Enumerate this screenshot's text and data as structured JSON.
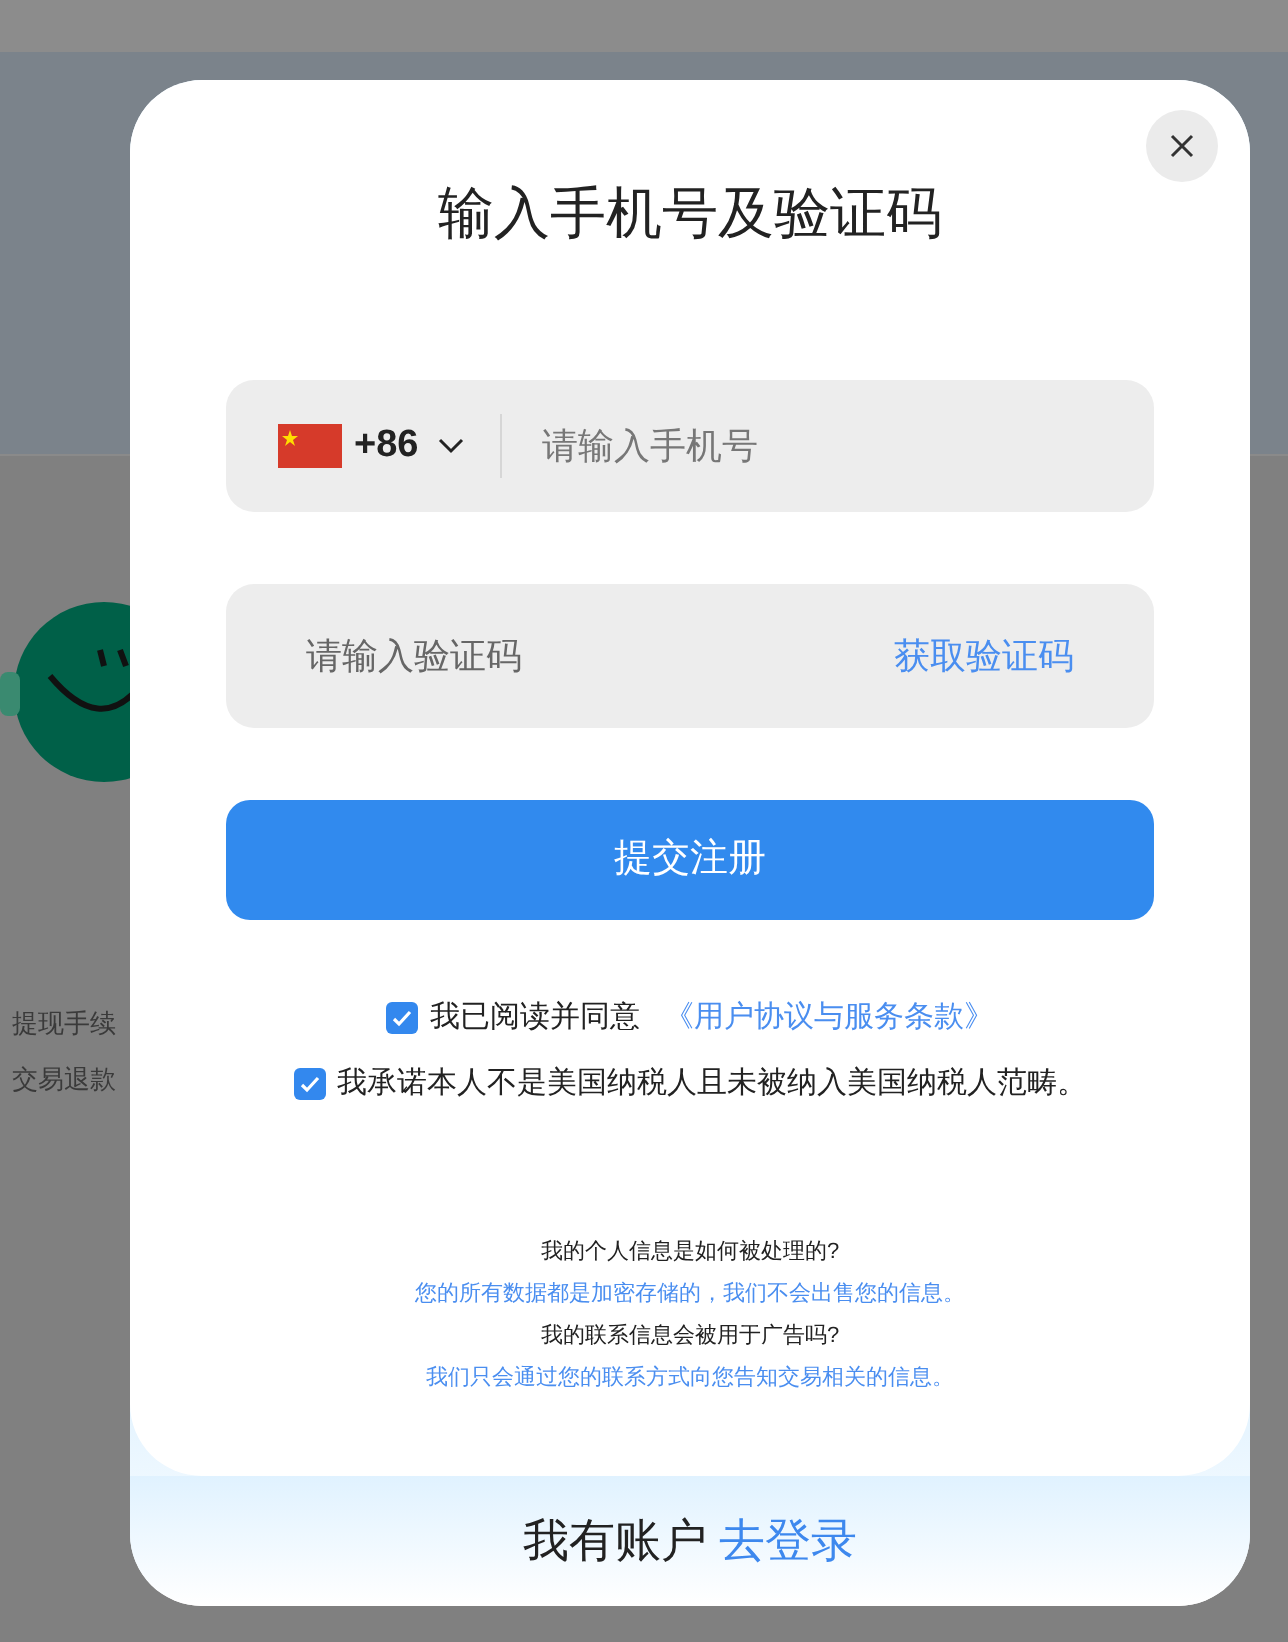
{
  "background": {
    "texts": [
      "提现手续",
      "交易退款"
    ]
  },
  "dialog": {
    "title": "输入手机号及验证码",
    "phone": {
      "country_code": "+86",
      "placeholder": "请输入手机号"
    },
    "code": {
      "placeholder": "请输入验证码",
      "get_code": "获取验证码"
    },
    "submit": "提交注册",
    "agreements": [
      {
        "text": "我已阅读并同意",
        "link": "《用户协议与服务条款》",
        "checked": true
      },
      {
        "text": "我承诺本人不是美国纳税人且未被纳入美国纳税人范畴。",
        "checked": true
      }
    ],
    "faq": [
      {
        "question": "我的个人信息是如何被处理的?",
        "answer": "您的所有数据都是加密存储的，我们不会出售您的信息。"
      },
      {
        "question": "我的联系信息会被用于广告吗?",
        "answer": "我们只会通过您的联系方式向您告知交易相关的信息。"
      }
    ],
    "footer": {
      "text": "我有账户",
      "link": "去登录"
    }
  }
}
